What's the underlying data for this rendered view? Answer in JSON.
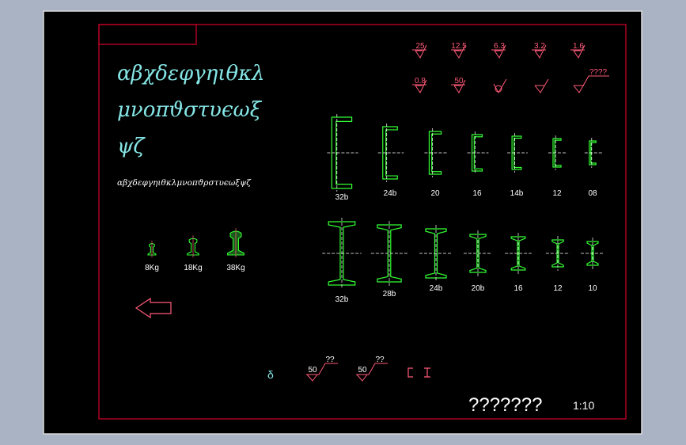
{
  "colors": {
    "viewport_bg": "#a9b3c4",
    "canvas_bg": "#000000",
    "border_red": "#d4002a",
    "symbol_pink": "#ff5a78",
    "profile_green": "#33ff33",
    "text_cyan": "#86e6e6",
    "text_white": "#ffffff"
  },
  "greek": {
    "line1": "αβχδεφγηιθκλ",
    "line2": "μνοπϑστυϵωξ",
    "line3": "ψζ",
    "small": "αβχδεφγηιθκλμνοπϑρστυϵωξψζ"
  },
  "roughness": {
    "row1": [
      "25",
      "12.5",
      "6.3",
      "3.2",
      "1.6"
    ],
    "row2": [
      "0.8",
      "50"
    ],
    "row2_extra": "????"
  },
  "channels": {
    "labels": [
      "32b",
      "24b",
      "20",
      "16",
      "14b",
      "12",
      "08"
    ],
    "heights": [
      90,
      66,
      54,
      46,
      42,
      36,
      30
    ]
  },
  "ibeams": {
    "labels": [
      "32b",
      "28b",
      "24b",
      "20b",
      "16",
      "12",
      "10"
    ],
    "heights": [
      80,
      72,
      62,
      48,
      42,
      34,
      30
    ]
  },
  "rails": {
    "labels": [
      "8Kg",
      "18Kg",
      "38Kg"
    ]
  },
  "bottom": {
    "delta": "δ",
    "weld_values": [
      "50",
      "50"
    ],
    "weld_marks": [
      "??",
      "??"
    ],
    "symbols": "⊏ I"
  },
  "title_block": {
    "title": "???????",
    "scale": "1:10"
  }
}
